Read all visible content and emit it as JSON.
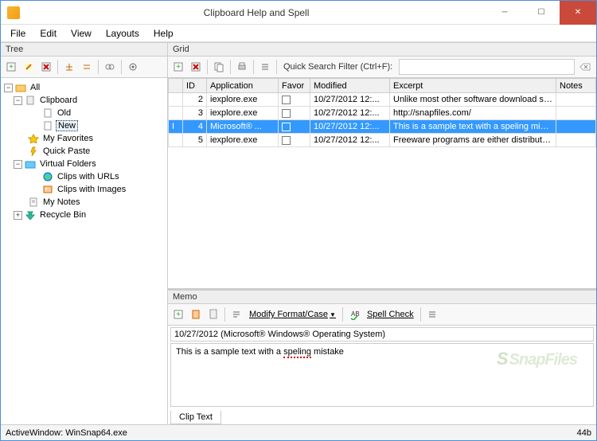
{
  "window": {
    "title": "Clipboard Help and Spell"
  },
  "menu": {
    "file": "File",
    "edit": "Edit",
    "view": "View",
    "layouts": "Layouts",
    "help": "Help"
  },
  "panes": {
    "tree": "Tree",
    "grid": "Grid",
    "memo": "Memo"
  },
  "tree": {
    "root": "All",
    "clipboard": "Clipboard",
    "old": "Old",
    "new": "New",
    "favorites": "My Favorites",
    "quickpaste": "Quick Paste",
    "virtual": "Virtual Folders",
    "clips_urls": "Clips with URLs",
    "clips_images": "Clips with Images",
    "notes": "My Notes",
    "recycle": "Recycle Bin"
  },
  "grid": {
    "search_label": "Quick Search Filter (Ctrl+F):",
    "search_value": "",
    "cols": {
      "id": "ID",
      "app": "Application",
      "favor": "Favor",
      "modified": "Modified",
      "excerpt": "Excerpt",
      "notes": "Notes"
    },
    "rows": [
      {
        "id": "2",
        "app": "iexplore.exe",
        "modified": "10/27/2012 12:...",
        "excerpt": "Unlike most other software download site...",
        "notes": ""
      },
      {
        "id": "3",
        "app": "iexplore.exe",
        "modified": "10/27/2012 12:...",
        "excerpt": "http://snapfiles.com/",
        "notes": ""
      },
      {
        "id": "4",
        "app": "Microsoft® ...",
        "modified": "10/27/2012 12:...",
        "excerpt": "This is a sample text with a speling mistake",
        "notes": ""
      },
      {
        "id": "5",
        "app": "iexplore.exe",
        "modified": "10/27/2012 12:...",
        "excerpt": "Freeware programs are either distributed f...",
        "notes": ""
      }
    ]
  },
  "memo": {
    "modify_label": "Modify Format/Case",
    "spellcheck_label": "Spell Check",
    "title_field": "10/27/2012 (Microsoft® Windows® Operating System)",
    "body_before": "This is a sample text with a ",
    "body_error": "speling",
    "body_after": " mistake",
    "tab": "Clip Text"
  },
  "status": {
    "left": "ActiveWindow: WinSnap64.exe",
    "right": "44b"
  }
}
